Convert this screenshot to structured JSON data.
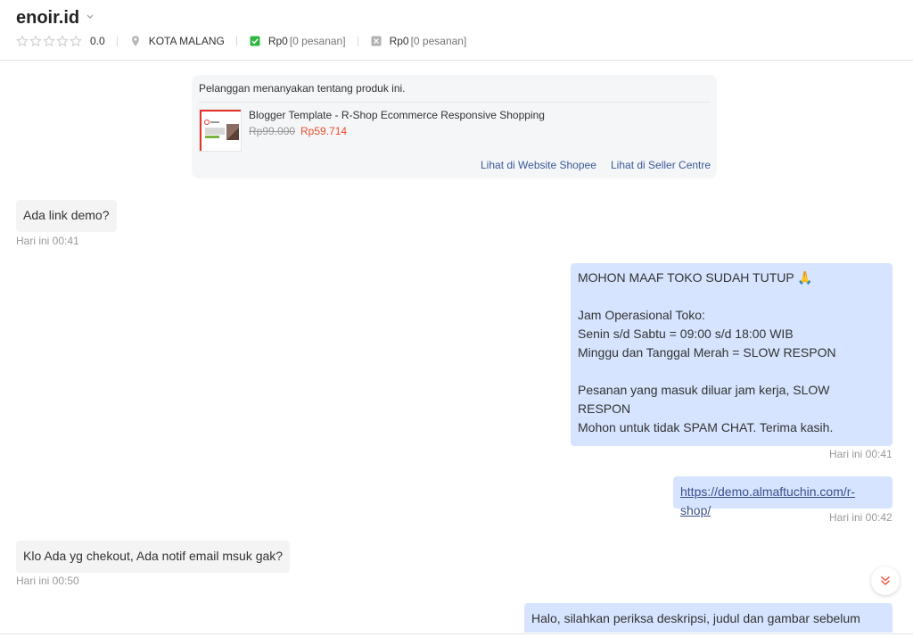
{
  "header": {
    "shop_name": "enoir.id",
    "rating": "0.0",
    "location": "KOTA MALANG",
    "completed": {
      "amount": "Rp0",
      "orders": "[0 pesanan]"
    },
    "cancelled": {
      "amount": "Rp0",
      "orders": "[0 pesanan]"
    },
    "colors": {
      "check": "#2db742",
      "cancel": "#b0b0b0"
    }
  },
  "product_card": {
    "title": "Pelanggan menanyakan tentang produk ini.",
    "product_name": "Blogger Template - R-Shop Ecommerce Responsive Shopping",
    "old_price": "Rp99.000",
    "new_price": "Rp59.714",
    "link_shopee": "Lihat di Website Shopee",
    "link_seller": "Lihat di Seller Centre"
  },
  "messages": [
    {
      "direction": "in",
      "text": "Ada link demo?",
      "time": "Hari ini 00:41"
    },
    {
      "direction": "out",
      "lines": [
        "MOHON MAAF TOKO SUDAH TUTUP 🙏",
        "",
        "Jam Operasional Toko:",
        "Senin s/d Sabtu = 09:00 s/d 18:00 WIB",
        "Minggu dan Tanggal Merah = SLOW RESPON",
        "",
        "Pesanan yang masuk diluar jam kerja, SLOW RESPON",
        "",
        "Mohon untuk tidak SPAM CHAT. Terima kasih."
      ],
      "time": "Hari ini 00:41"
    },
    {
      "direction": "out",
      "text": "https://demo.almaftuchin.com/r-shop/",
      "time": "Hari ini 00:42"
    },
    {
      "direction": "in",
      "text": "Klo Ada yg chekout, Ada notif email msuk gak?",
      "time": "Hari ini 00:50"
    },
    {
      "direction": "out",
      "text": "Halo, silahkan periksa deskripsi, judul dan gambar sebelum"
    }
  ],
  "colors": {
    "bubble_out": "#d6e4ff",
    "bubble_in": "#f4f4f4",
    "price": "#ee4d2d",
    "link": "#3b5998"
  }
}
